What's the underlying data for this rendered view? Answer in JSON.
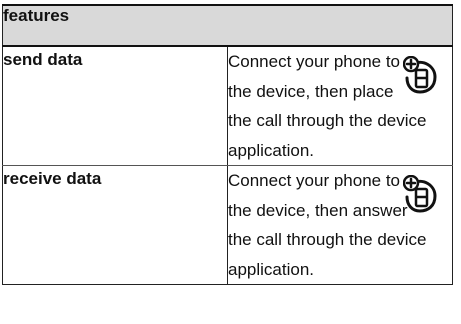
{
  "table": {
    "header": "features",
    "rows": [
      {
        "feature": "send data",
        "description_lines": [
          "Connect your phone to",
          "the device, then place",
          "the call through the device",
          "application."
        ],
        "icon": "network-feature-icon"
      },
      {
        "feature": "receive data",
        "description_lines": [
          "Connect your phone to",
          "the device, then answer",
          "the call through the device",
          "application."
        ],
        "icon": "network-feature-icon"
      }
    ]
  }
}
